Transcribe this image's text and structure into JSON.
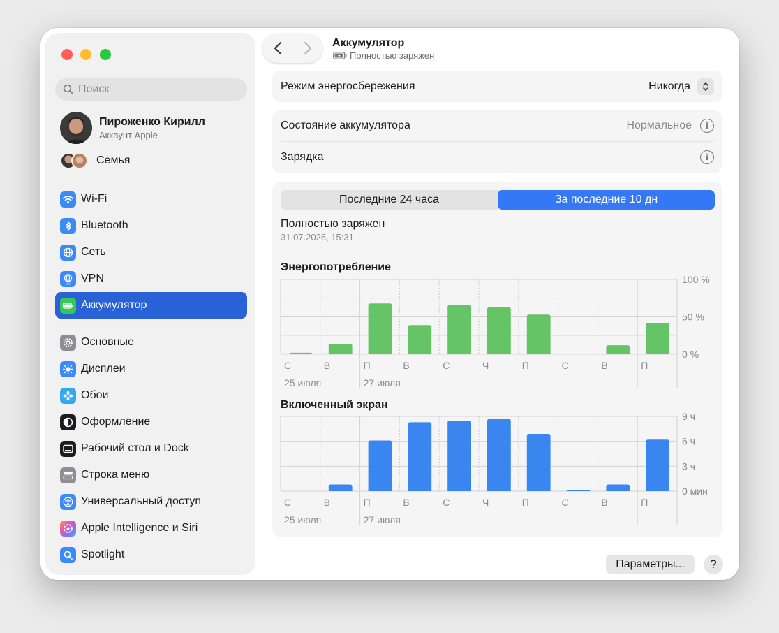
{
  "sidebar": {
    "search_placeholder": "Поиск",
    "profile": {
      "name": "Пироженко Кирилл",
      "subtitle": "Аккаунт Apple"
    },
    "family_label": "Семья",
    "items": [
      {
        "label": "Wi-Fi",
        "icon": "wifi-icon",
        "color": "#3a8af7"
      },
      {
        "label": "Bluetooth",
        "icon": "bluetooth-icon",
        "color": "#3a8af7"
      },
      {
        "label": "Сеть",
        "icon": "globe-icon",
        "color": "#3a8af7"
      },
      {
        "label": "VPN",
        "icon": "vpn-globe-icon",
        "color": "#3a8af7"
      },
      {
        "label": "Аккумулятор",
        "icon": "battery-icon",
        "color": "#34c759",
        "selected": true
      },
      {
        "label": "Основные",
        "icon": "gear-icon",
        "color": "#8e8e93"
      },
      {
        "label": "Дисплеи",
        "icon": "sun-icon",
        "color": "#3a8af7"
      },
      {
        "label": "Обои",
        "icon": "flower-icon",
        "color": "#36a8f0"
      },
      {
        "label": "Оформление",
        "icon": "appearance-icon",
        "color": "#1c1c1e"
      },
      {
        "label": "Рабочий стол и Dock",
        "icon": "dock-icon",
        "color": "#1c1c1e"
      },
      {
        "label": "Строка меню",
        "icon": "menubar-icon",
        "color": "#8e8e93"
      },
      {
        "label": "Универсальный доступ",
        "icon": "accessibility-icon",
        "color": "#3a8af7"
      },
      {
        "label": "Apple Intelligence и Siri",
        "icon": "siri-icon",
        "color": "#f0a0c0"
      },
      {
        "label": "Spotlight",
        "icon": "magnifier-icon",
        "color": "#3a8af7"
      }
    ]
  },
  "header": {
    "title": "Аккумулятор",
    "subtitle": "Полностью заряжен"
  },
  "settings": {
    "low_power": {
      "label": "Режим энергосбережения",
      "value": "Никогда"
    },
    "health": {
      "label": "Состояние аккумулятора",
      "value": "Нормальное"
    },
    "charging": {
      "label": "Зарядка"
    }
  },
  "usage": {
    "tabs": [
      "Последние 24 часа",
      "За последние 10 дн"
    ],
    "active_tab": 1,
    "charge_status": "Полностью заряжен",
    "charge_time": "31.07.2026, 15:31"
  },
  "footer": {
    "params_label": "Параметры...",
    "help_label": "?"
  },
  "chart_data": [
    {
      "type": "bar",
      "title": "Энергопотребление",
      "categories": [
        "С",
        "В",
        "П",
        "В",
        "С",
        "Ч",
        "П",
        "С",
        "В",
        "П"
      ],
      "date_labels": [
        {
          "index": 0,
          "text": "25 июля"
        },
        {
          "index": 2,
          "text": "27 июля"
        }
      ],
      "values": [
        2,
        14,
        68,
        39,
        66,
        63,
        53,
        0,
        12,
        42
      ],
      "y_ticks": [
        "100 %",
        "50 %",
        "0 %"
      ],
      "ylim": [
        0,
        100
      ],
      "color": "#65c466"
    },
    {
      "type": "bar",
      "title": "Включенный экран",
      "categories": [
        "С",
        "В",
        "П",
        "В",
        "С",
        "Ч",
        "П",
        "С",
        "В",
        "П"
      ],
      "date_labels": [
        {
          "index": 0,
          "text": "25 июля"
        },
        {
          "index": 2,
          "text": "27 июля"
        }
      ],
      "values": [
        0,
        0.8,
        6.1,
        8.3,
        8.5,
        8.7,
        6.9,
        0.1,
        0.8,
        6.2
      ],
      "y_ticks": [
        "9 ч",
        "6 ч",
        "3 ч",
        "0 мин"
      ],
      "ylim": [
        0,
        9
      ],
      "color": "#3a86f0"
    }
  ]
}
